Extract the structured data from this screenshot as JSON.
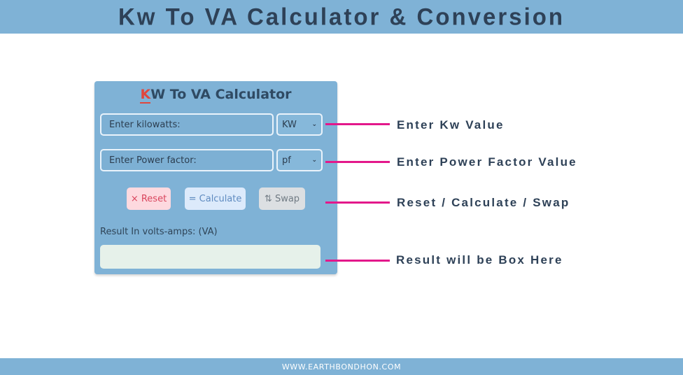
{
  "header": {
    "title": "Kw To VA Calculator & Conversion"
  },
  "calculator": {
    "title_first_letter": "K",
    "title_rest": "W To VA Calculator",
    "kw_input": {
      "placeholder": "Enter kilowatts:",
      "value": ""
    },
    "kw_unit_select": {
      "selected": "KW"
    },
    "pf_input": {
      "placeholder": "Enter Power factor:",
      "value": ""
    },
    "pf_unit_select": {
      "selected": "pf"
    },
    "buttons": {
      "reset": "× Reset",
      "calculate": "= Calculate",
      "swap": "⇅ Swap"
    },
    "result_label": "Result In volts-amps: (VA)",
    "result_value": ""
  },
  "annotations": [
    "Enter Kw Value",
    "Enter Power Factor Value",
    "Reset / Calculate / Swap",
    "Result will be Box Here"
  ],
  "colors": {
    "banner": "#7fb2d6",
    "pointer": "#e3188b",
    "text_dark": "#2e4157",
    "accent_red": "#e0463d"
  },
  "footer": {
    "website": "WWW.EARTHBONDHON.COM"
  }
}
